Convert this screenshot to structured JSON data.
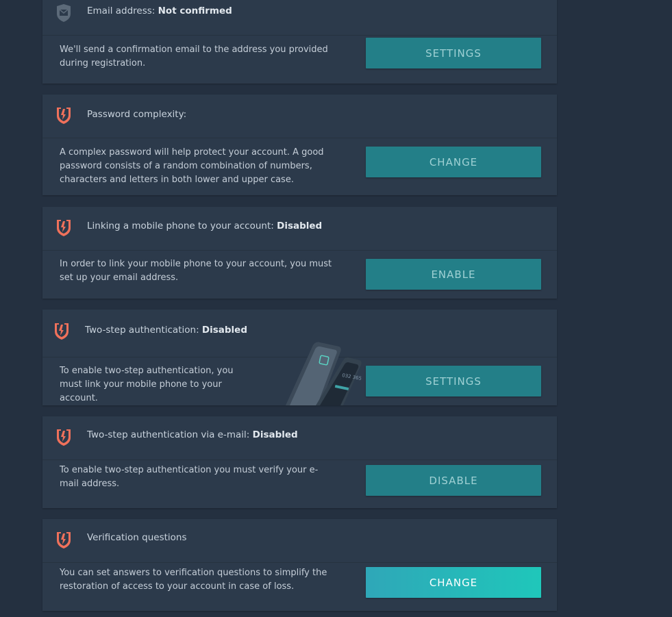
{
  "cards": [
    {
      "title": "Email address: ",
      "status": "Not confirmed",
      "icon": "mail-shield-icon",
      "description": "We'll send a confirmation email to the address you provided during registration.",
      "button": "SETTINGS"
    },
    {
      "title": "Password complexity:",
      "status": "",
      "icon": "warning-shield-icon",
      "description": "A complex password will help protect your account. A good password consists of a random combination of numbers, characters and letters in both lower and upper case.",
      "button": "CHANGE"
    },
    {
      "title": "Linking a mobile phone to your account: ",
      "status": "Disabled",
      "icon": "warning-shield-icon",
      "description": "In order to link your mobile phone to your account, you must set up your email address.",
      "button": "ENABLE"
    },
    {
      "title": "Two-step authentication: ",
      "status": "Disabled",
      "icon": "warning-shield-icon",
      "description": "To enable two-step authentication, you must link your mobile phone to your account.",
      "button": "SETTINGS",
      "illustration_text": "032 365"
    },
    {
      "title": "Two-step authentication via e-mail: ",
      "status": "Disabled",
      "icon": "warning-shield-icon",
      "description": "To enable two-step authentication you must verify your e-mail address.",
      "button": "DISABLE"
    },
    {
      "title": "Verification questions",
      "status": "",
      "icon": "warning-shield-icon",
      "description": "You can set answers to verification questions to simplify the restoration of access to your account in case of loss.",
      "button": "CHANGE"
    }
  ],
  "colors": {
    "background": "#243040",
    "card": "#2c3a4b",
    "button": "#237f88",
    "button_active_start": "#2fa7b8",
    "button_active_end": "#1fc7ba",
    "warning_icon": "#f0715b"
  }
}
